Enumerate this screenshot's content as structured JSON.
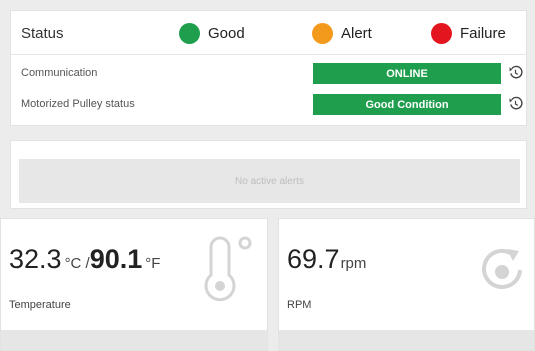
{
  "status": {
    "title": "Status",
    "legend": [
      {
        "label": "Good",
        "color": "#1f9e4d"
      },
      {
        "label": "Alert",
        "color": "#f39a1d"
      },
      {
        "label": "Failure",
        "color": "#e3161f"
      }
    ],
    "rows": [
      {
        "label": "Communication",
        "value": "ONLINE",
        "color": "#1f9e4d"
      },
      {
        "label": "Motorized Pulley status",
        "value": "Good Condition",
        "color": "#1f9e4d"
      }
    ]
  },
  "alerts": {
    "message": "No active alerts"
  },
  "metrics": {
    "temperature": {
      "celsius": "32.3",
      "celsius_unit": "°C / ",
      "fahrenheit": "90.1",
      "fahrenheit_unit": "°F",
      "label": "Temperature",
      "icon": "thermometer-icon"
    },
    "rpm": {
      "value": "69.7",
      "unit": "rpm",
      "label": "RPM",
      "icon": "rotation-icon"
    }
  }
}
